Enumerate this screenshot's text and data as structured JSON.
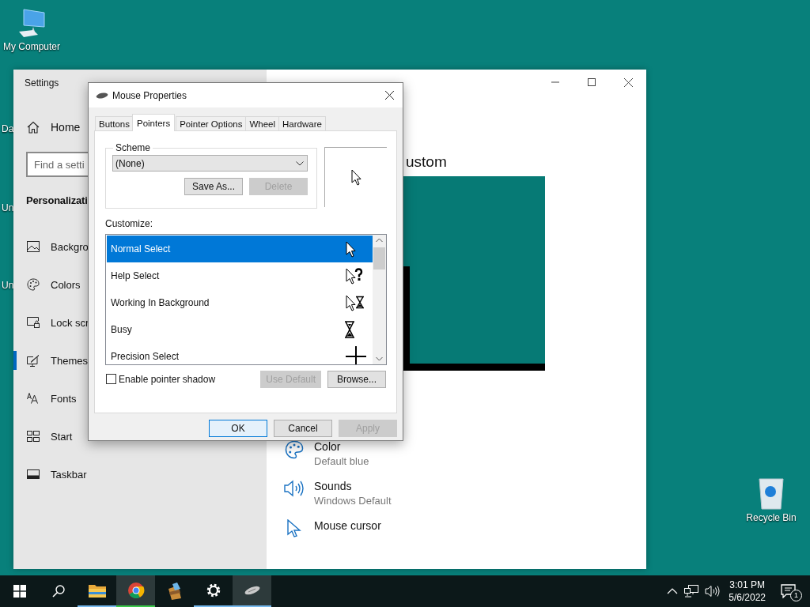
{
  "desktop": {
    "icons": [
      {
        "label": "My Computer",
        "kind": "computer"
      },
      {
        "label": "Recycle Bin",
        "kind": "recycle"
      }
    ],
    "hidden_icons": [
      {
        "label": "Da"
      },
      {
        "label": "Un"
      },
      {
        "label": "Un"
      }
    ]
  },
  "settings": {
    "title": "Settings",
    "home": "Home",
    "search": {
      "placeholder": "Find a setti"
    },
    "section": "Personalizati",
    "nav": [
      {
        "label": "Backgro",
        "kind": "picture",
        "selected": false
      },
      {
        "label": "Colors",
        "kind": "palette",
        "selected": false
      },
      {
        "label": "Lock scr",
        "kind": "lock",
        "selected": false
      },
      {
        "label": "Themes",
        "kind": "themes",
        "selected": true
      },
      {
        "label": "Fonts",
        "kind": "fonts",
        "selected": false
      },
      {
        "label": "Start",
        "kind": "start",
        "selected": false
      },
      {
        "label": "Taskbar",
        "kind": "taskbar",
        "selected": false
      }
    ],
    "heading": "ustom",
    "options": [
      {
        "title": "Color",
        "subtitle": "Default blue",
        "kind": "palette"
      },
      {
        "title": "Sounds",
        "subtitle": "Windows Default",
        "kind": "speaker"
      },
      {
        "title": "Mouse cursor",
        "kind": "cursor"
      }
    ]
  },
  "dialog": {
    "title": "Mouse Properties",
    "tabs": [
      {
        "label": "Buttons",
        "selected": false
      },
      {
        "label": "Pointers",
        "selected": true
      },
      {
        "label": "Pointer Options",
        "selected": false
      },
      {
        "label": "Wheel",
        "selected": false
      },
      {
        "label": "Hardware",
        "selected": false
      }
    ],
    "scheme": {
      "label": "Scheme",
      "value": "(None)",
      "buttons": [
        {
          "label": "Save As...",
          "disabled": false
        },
        {
          "label": "Delete",
          "disabled": true
        }
      ]
    },
    "customize_label": "Customize:",
    "cursors": [
      {
        "name": "Normal Select",
        "kind": "arrow",
        "selected": true
      },
      {
        "name": "Help Select",
        "kind": "help",
        "selected": false
      },
      {
        "name": "Working In Background",
        "kind": "working",
        "selected": false
      },
      {
        "name": "Busy",
        "kind": "busy",
        "selected": false
      },
      {
        "name": "Precision Select",
        "kind": "cross",
        "selected": false
      }
    ],
    "shadow": {
      "label": "Enable pointer shadow",
      "checked": false
    },
    "list_buttons": [
      {
        "label": "Use Default",
        "disabled": true
      },
      {
        "label": "Browse...",
        "disabled": false
      }
    ],
    "footer_buttons": [
      {
        "label": "OK",
        "disabled": false,
        "default": true
      },
      {
        "label": "Cancel",
        "disabled": false,
        "default": false
      },
      {
        "label": "Apply",
        "disabled": true,
        "default": false
      }
    ]
  },
  "taskbar": {
    "apps": [
      {
        "kind": "explorer",
        "running": true,
        "active": false
      },
      {
        "kind": "chrome",
        "running": true,
        "active": true
      },
      {
        "kind": "archiver",
        "running": false,
        "active": false
      },
      {
        "kind": "settings",
        "running": true,
        "active": false
      },
      {
        "kind": "mouse",
        "running": true,
        "active": true
      }
    ],
    "time": "3:01 PM",
    "date": "5/6/2022",
    "notifications": "1"
  }
}
